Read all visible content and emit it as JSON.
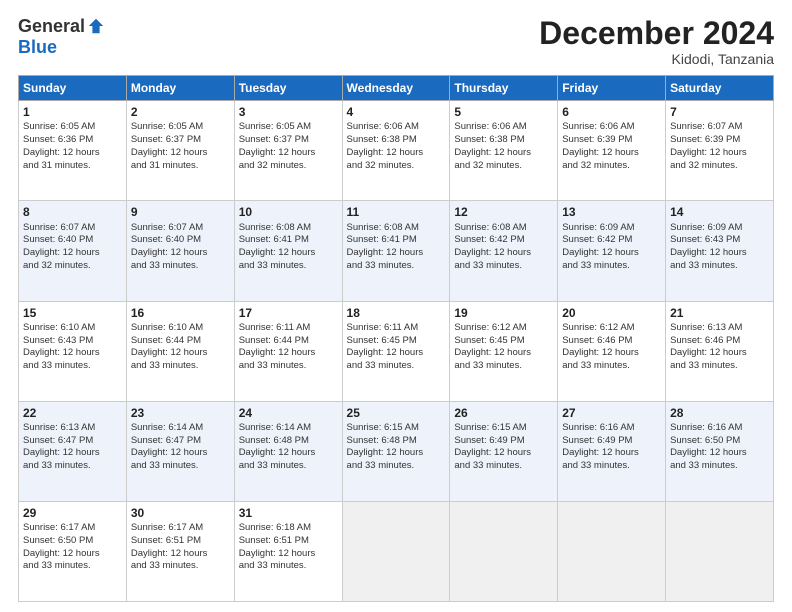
{
  "logo": {
    "general": "General",
    "blue": "Blue"
  },
  "title": "December 2024",
  "subtitle": "Kidodi, Tanzania",
  "days": [
    "Sunday",
    "Monday",
    "Tuesday",
    "Wednesday",
    "Thursday",
    "Friday",
    "Saturday"
  ],
  "weeks": [
    [
      {
        "num": "1",
        "line1": "Sunrise: 6:05 AM",
        "line2": "Sunset: 6:36 PM",
        "line3": "Daylight: 12 hours",
        "line4": "and 31 minutes."
      },
      {
        "num": "2",
        "line1": "Sunrise: 6:05 AM",
        "line2": "Sunset: 6:37 PM",
        "line3": "Daylight: 12 hours",
        "line4": "and 31 minutes."
      },
      {
        "num": "3",
        "line1": "Sunrise: 6:05 AM",
        "line2": "Sunset: 6:37 PM",
        "line3": "Daylight: 12 hours",
        "line4": "and 32 minutes."
      },
      {
        "num": "4",
        "line1": "Sunrise: 6:06 AM",
        "line2": "Sunset: 6:38 PM",
        "line3": "Daylight: 12 hours",
        "line4": "and 32 minutes."
      },
      {
        "num": "5",
        "line1": "Sunrise: 6:06 AM",
        "line2": "Sunset: 6:38 PM",
        "line3": "Daylight: 12 hours",
        "line4": "and 32 minutes."
      },
      {
        "num": "6",
        "line1": "Sunrise: 6:06 AM",
        "line2": "Sunset: 6:39 PM",
        "line3": "Daylight: 12 hours",
        "line4": "and 32 minutes."
      },
      {
        "num": "7",
        "line1": "Sunrise: 6:07 AM",
        "line2": "Sunset: 6:39 PM",
        "line3": "Daylight: 12 hours",
        "line4": "and 32 minutes."
      }
    ],
    [
      {
        "num": "8",
        "line1": "Sunrise: 6:07 AM",
        "line2": "Sunset: 6:40 PM",
        "line3": "Daylight: 12 hours",
        "line4": "and 32 minutes."
      },
      {
        "num": "9",
        "line1": "Sunrise: 6:07 AM",
        "line2": "Sunset: 6:40 PM",
        "line3": "Daylight: 12 hours",
        "line4": "and 33 minutes."
      },
      {
        "num": "10",
        "line1": "Sunrise: 6:08 AM",
        "line2": "Sunset: 6:41 PM",
        "line3": "Daylight: 12 hours",
        "line4": "and 33 minutes."
      },
      {
        "num": "11",
        "line1": "Sunrise: 6:08 AM",
        "line2": "Sunset: 6:41 PM",
        "line3": "Daylight: 12 hours",
        "line4": "and 33 minutes."
      },
      {
        "num": "12",
        "line1": "Sunrise: 6:08 AM",
        "line2": "Sunset: 6:42 PM",
        "line3": "Daylight: 12 hours",
        "line4": "and 33 minutes."
      },
      {
        "num": "13",
        "line1": "Sunrise: 6:09 AM",
        "line2": "Sunset: 6:42 PM",
        "line3": "Daylight: 12 hours",
        "line4": "and 33 minutes."
      },
      {
        "num": "14",
        "line1": "Sunrise: 6:09 AM",
        "line2": "Sunset: 6:43 PM",
        "line3": "Daylight: 12 hours",
        "line4": "and 33 minutes."
      }
    ],
    [
      {
        "num": "15",
        "line1": "Sunrise: 6:10 AM",
        "line2": "Sunset: 6:43 PM",
        "line3": "Daylight: 12 hours",
        "line4": "and 33 minutes."
      },
      {
        "num": "16",
        "line1": "Sunrise: 6:10 AM",
        "line2": "Sunset: 6:44 PM",
        "line3": "Daylight: 12 hours",
        "line4": "and 33 minutes."
      },
      {
        "num": "17",
        "line1": "Sunrise: 6:11 AM",
        "line2": "Sunset: 6:44 PM",
        "line3": "Daylight: 12 hours",
        "line4": "and 33 minutes."
      },
      {
        "num": "18",
        "line1": "Sunrise: 6:11 AM",
        "line2": "Sunset: 6:45 PM",
        "line3": "Daylight: 12 hours",
        "line4": "and 33 minutes."
      },
      {
        "num": "19",
        "line1": "Sunrise: 6:12 AM",
        "line2": "Sunset: 6:45 PM",
        "line3": "Daylight: 12 hours",
        "line4": "and 33 minutes."
      },
      {
        "num": "20",
        "line1": "Sunrise: 6:12 AM",
        "line2": "Sunset: 6:46 PM",
        "line3": "Daylight: 12 hours",
        "line4": "and 33 minutes."
      },
      {
        "num": "21",
        "line1": "Sunrise: 6:13 AM",
        "line2": "Sunset: 6:46 PM",
        "line3": "Daylight: 12 hours",
        "line4": "and 33 minutes."
      }
    ],
    [
      {
        "num": "22",
        "line1": "Sunrise: 6:13 AM",
        "line2": "Sunset: 6:47 PM",
        "line3": "Daylight: 12 hours",
        "line4": "and 33 minutes."
      },
      {
        "num": "23",
        "line1": "Sunrise: 6:14 AM",
        "line2": "Sunset: 6:47 PM",
        "line3": "Daylight: 12 hours",
        "line4": "and 33 minutes."
      },
      {
        "num": "24",
        "line1": "Sunrise: 6:14 AM",
        "line2": "Sunset: 6:48 PM",
        "line3": "Daylight: 12 hours",
        "line4": "and 33 minutes."
      },
      {
        "num": "25",
        "line1": "Sunrise: 6:15 AM",
        "line2": "Sunset: 6:48 PM",
        "line3": "Daylight: 12 hours",
        "line4": "and 33 minutes."
      },
      {
        "num": "26",
        "line1": "Sunrise: 6:15 AM",
        "line2": "Sunset: 6:49 PM",
        "line3": "Daylight: 12 hours",
        "line4": "and 33 minutes."
      },
      {
        "num": "27",
        "line1": "Sunrise: 6:16 AM",
        "line2": "Sunset: 6:49 PM",
        "line3": "Daylight: 12 hours",
        "line4": "and 33 minutes."
      },
      {
        "num": "28",
        "line1": "Sunrise: 6:16 AM",
        "line2": "Sunset: 6:50 PM",
        "line3": "Daylight: 12 hours",
        "line4": "and 33 minutes."
      }
    ],
    [
      {
        "num": "29",
        "line1": "Sunrise: 6:17 AM",
        "line2": "Sunset: 6:50 PM",
        "line3": "Daylight: 12 hours",
        "line4": "and 33 minutes."
      },
      {
        "num": "30",
        "line1": "Sunrise: 6:17 AM",
        "line2": "Sunset: 6:51 PM",
        "line3": "Daylight: 12 hours",
        "line4": "and 33 minutes."
      },
      {
        "num": "31",
        "line1": "Sunrise: 6:18 AM",
        "line2": "Sunset: 6:51 PM",
        "line3": "Daylight: 12 hours",
        "line4": "and 33 minutes."
      },
      null,
      null,
      null,
      null
    ]
  ]
}
